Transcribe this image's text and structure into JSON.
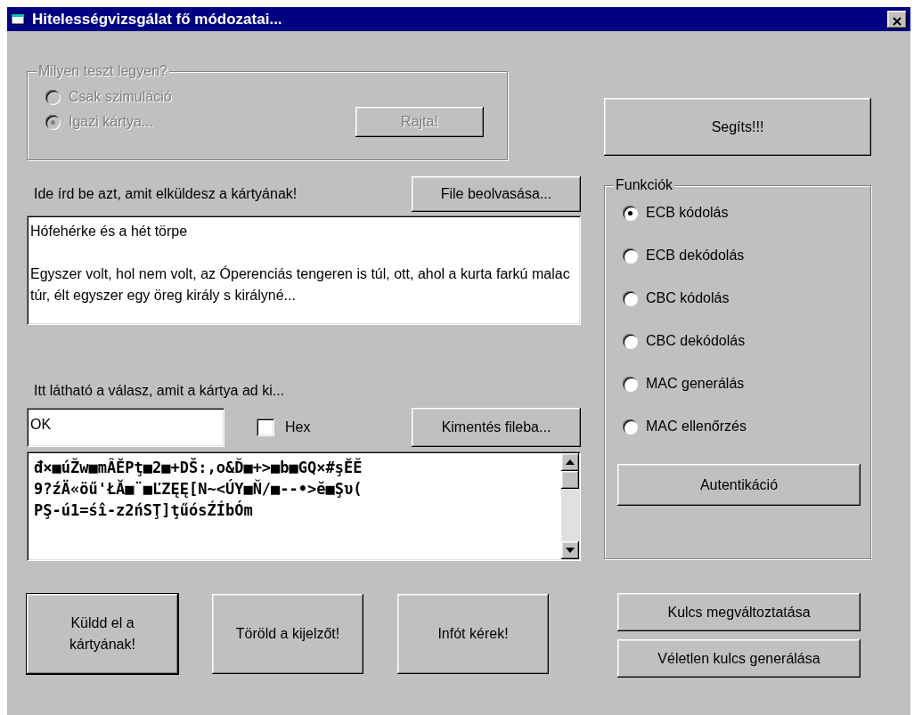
{
  "window": {
    "title": "Hitelességvizsgálat fő módozatai..."
  },
  "test_group": {
    "legend": "Milyen teszt legyen?",
    "disabled": true,
    "options": [
      {
        "label": "Csak szimuláció",
        "selected": false
      },
      {
        "label": "Igazi kártya...",
        "selected": true
      }
    ],
    "run_button": "Rajta!"
  },
  "help_button": "Segíts!!!",
  "input": {
    "label": "Ide írd be azt, amit elküldesz a kártyának!",
    "load_button": "File beolvasása...",
    "value": "Hófehérke és a hét törpe\n\nEgyszer volt, hol nem volt, az Óperenciás tengeren is túl, ott, ahol a kurta farkú malac túr, élt egyszer egy öreg király s királyné..."
  },
  "response": {
    "label": "Itt látható a válasz, amit a kártya ad ki...",
    "status": "OK",
    "hex": {
      "label": "Hex",
      "checked": false
    },
    "save_button": "Kimentés fileba...",
    "value": "đ×■úŽw■mÂĔPţ■2■+DŠ:,o&Ď■+>■b■GQ×#şĔĚ\n9?źÄ«öű'ŁĂ■¨■ĽZĘĘ[Ν~<ÚY■Ň/■--•>ĕ■Şυ(\nPŞ-ú1=śî-z2ńSŢ]ţűósŹÍbÓm"
  },
  "functions": {
    "legend": "Funkciók",
    "options": [
      {
        "label": "ECB kódolás",
        "selected": true
      },
      {
        "label": "ECB dekódolás",
        "selected": false
      },
      {
        "label": "CBC kódolás",
        "selected": false
      },
      {
        "label": "CBC dekódolás",
        "selected": false
      },
      {
        "label": "MAC generálás",
        "selected": false
      },
      {
        "label": "MAC ellenőrzés",
        "selected": false
      }
    ],
    "auth_button": "Autentikáció"
  },
  "actions": [
    "Küldd el a kártyának!",
    "Töröld a kijelzőt!",
    "Infót kérek!"
  ],
  "key_buttons": [
    "Kulcs megváltoztatása",
    "Véletlen kulcs generálása"
  ]
}
